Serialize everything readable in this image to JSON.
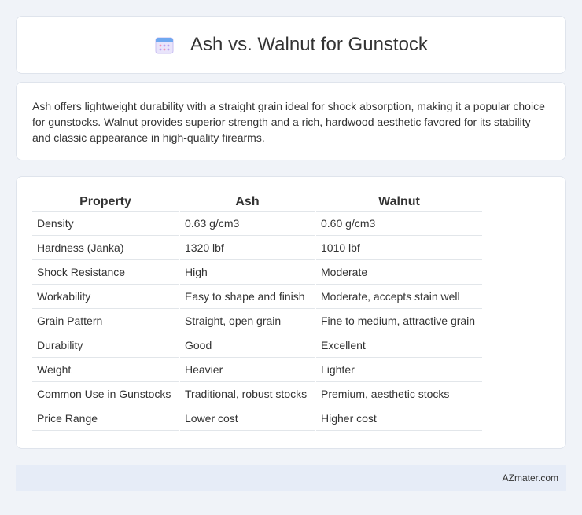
{
  "header": {
    "title": "Ash vs. Walnut for Gunstock",
    "icon": "calendar-icon"
  },
  "intro": {
    "text": "Ash offers lightweight durability with a straight grain ideal for shock absorption, making it a popular choice for gunstocks. Walnut provides superior strength and a rich, hardwood aesthetic favored for its stability and classic appearance in high-quality firearms."
  },
  "table": {
    "headers": [
      "Property",
      "Ash",
      "Walnut"
    ],
    "rows": [
      [
        "Density",
        "0.63 g/cm3",
        "0.60 g/cm3"
      ],
      [
        "Hardness (Janka)",
        "1320 lbf",
        "1010 lbf"
      ],
      [
        "Shock Resistance",
        "High",
        "Moderate"
      ],
      [
        "Workability",
        "Easy to shape and finish",
        "Moderate, accepts stain well"
      ],
      [
        "Grain Pattern",
        "Straight, open grain",
        "Fine to medium, attractive grain"
      ],
      [
        "Durability",
        "Good",
        "Excellent"
      ],
      [
        "Weight",
        "Heavier",
        "Lighter"
      ],
      [
        "Common Use in Gunstocks",
        "Traditional, robust stocks",
        "Premium, aesthetic stocks"
      ],
      [
        "Price Range",
        "Lower cost",
        "Higher cost"
      ]
    ]
  },
  "footer": {
    "brand": "AZmater.com"
  }
}
